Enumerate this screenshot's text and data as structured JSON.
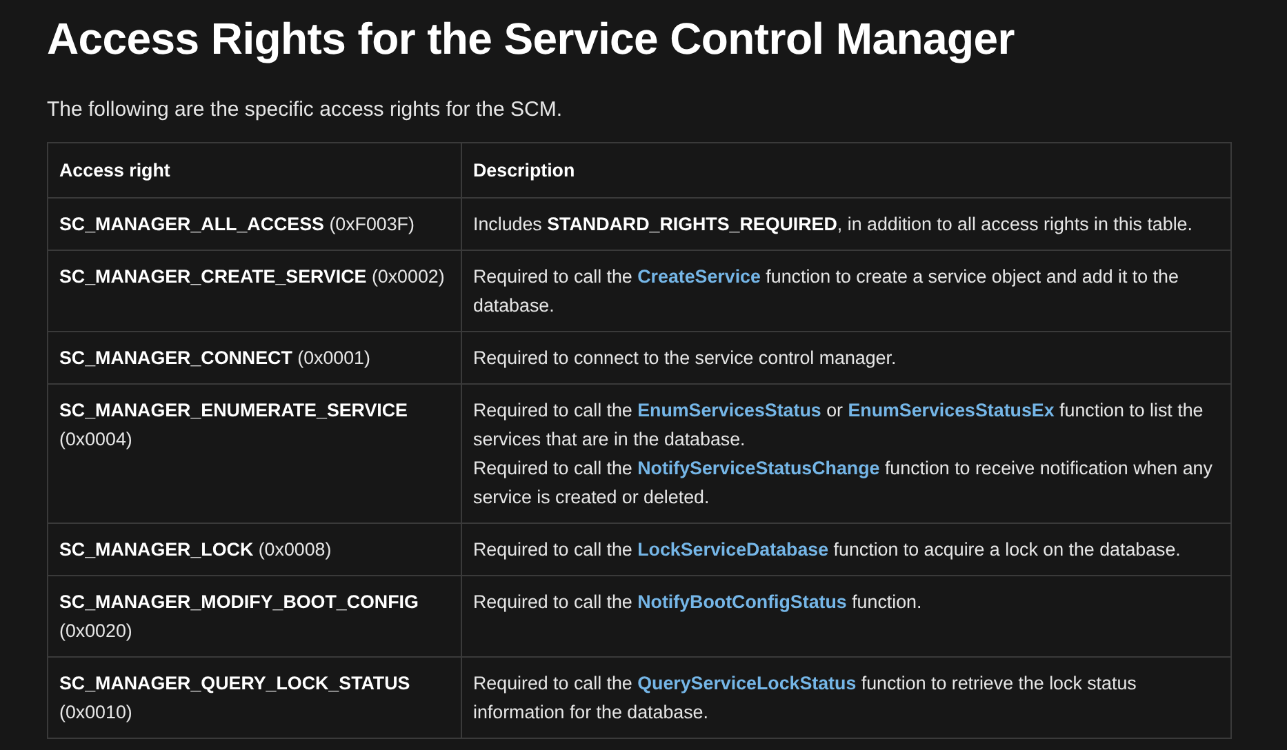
{
  "title": "Access Rights for the Service Control Manager",
  "intro": "The following are the specific access rights for the SCM.",
  "table": {
    "columns": [
      "Access right",
      "Description"
    ],
    "rows": [
      {
        "right": "**SC_MANAGER_ALL_ACCESS** (0xF003F)",
        "description": [
          [
            {
              "kind": "text",
              "text": "Includes **STANDARD_RIGHTS_REQUIRED**, in addition to all access rights in this table."
            }
          ]
        ]
      },
      {
        "right": "**SC_MANAGER_CREATE_SERVICE** (0x0002)",
        "description": [
          [
            {
              "kind": "text",
              "text": "Required to call the "
            },
            {
              "kind": "link",
              "text": "CreateService"
            },
            {
              "kind": "text",
              "text": " function to create a service object and add it to the database."
            }
          ]
        ]
      },
      {
        "right": "**SC_MANAGER_CONNECT** (0x0001)",
        "description": [
          [
            {
              "kind": "text",
              "text": "Required to connect to the service control manager."
            }
          ]
        ]
      },
      {
        "right": "**SC_MANAGER_ENUMERATE_SERVICE** (0x0004)",
        "description": [
          [
            {
              "kind": "text",
              "text": "Required to call the "
            },
            {
              "kind": "link",
              "text": "EnumServicesStatus"
            },
            {
              "kind": "text",
              "text": " or "
            },
            {
              "kind": "link",
              "text": "EnumServicesStatusEx"
            },
            {
              "kind": "text",
              "text": " function to list the services that are in the database."
            }
          ],
          [
            {
              "kind": "text",
              "text": "Required to call the "
            },
            {
              "kind": "link",
              "text": "NotifyServiceStatusChange"
            },
            {
              "kind": "text",
              "text": " function to receive notification when any service is created or deleted."
            }
          ]
        ]
      },
      {
        "right": "**SC_MANAGER_LOCK** (0x0008)",
        "description": [
          [
            {
              "kind": "text",
              "text": "Required to call the "
            },
            {
              "kind": "link",
              "text": "LockServiceDatabase"
            },
            {
              "kind": "text",
              "text": " function to acquire a lock on the database."
            }
          ]
        ]
      },
      {
        "right": "**SC_MANAGER_MODIFY_BOOT_CONFIG** (0x0020)",
        "description": [
          [
            {
              "kind": "text",
              "text": "Required to call the "
            },
            {
              "kind": "link",
              "text": "NotifyBootConfigStatus"
            },
            {
              "kind": "text",
              "text": " function."
            }
          ]
        ]
      },
      {
        "right": "**SC_MANAGER_QUERY_LOCK_STATUS** (0x0010)",
        "description": [
          [
            {
              "kind": "text",
              "text": "Required to call the "
            },
            {
              "kind": "link",
              "text": "QueryServiceLockStatus"
            },
            {
              "kind": "text",
              "text": " function to retrieve the lock status information for the database."
            }
          ]
        ]
      }
    ]
  }
}
